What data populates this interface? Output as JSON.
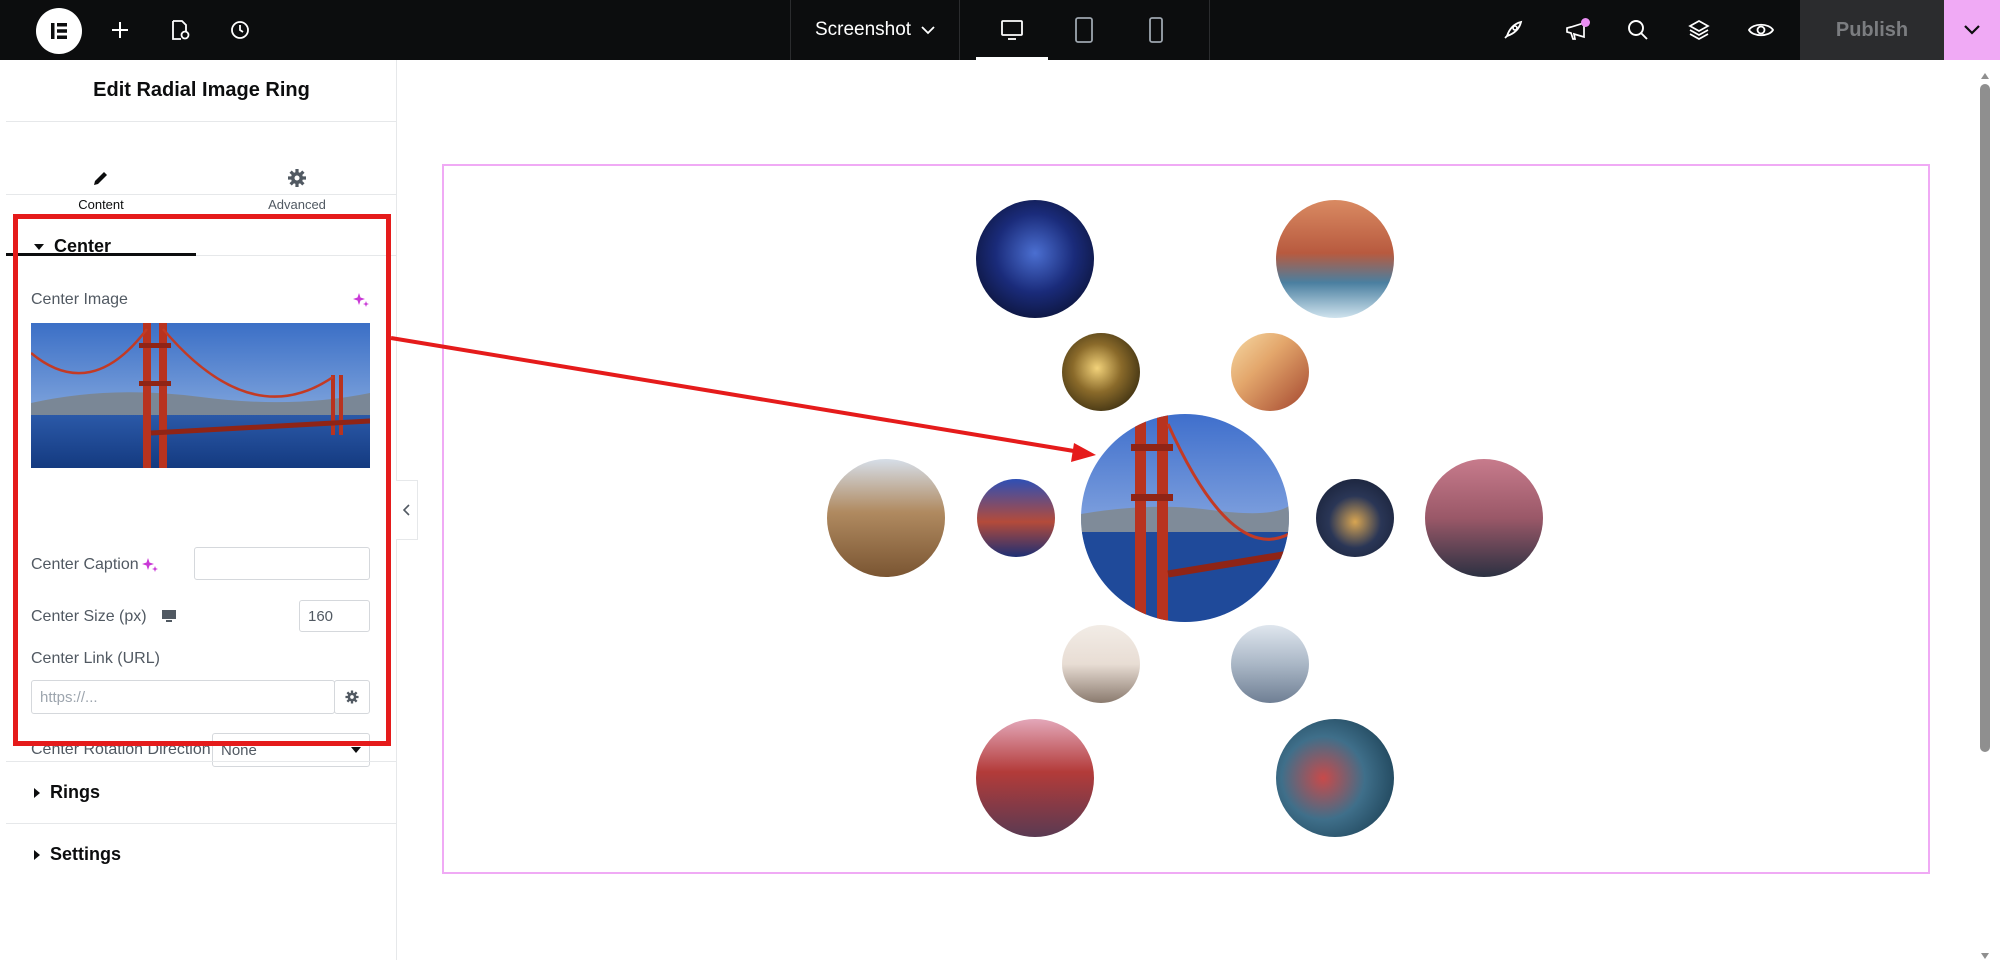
{
  "topbar": {
    "doc_title": "Screenshot",
    "publish_label": "Publish",
    "icons": [
      "elementor-logo-icon",
      "add-icon",
      "page-settings-icon",
      "history-icon",
      "desktop-icon",
      "tablet-icon",
      "mobile-icon",
      "rocket-icon",
      "announcement-icon",
      "search-icon",
      "layers-icon",
      "preview-eye-icon",
      "chevron-down-icon"
    ]
  },
  "panel": {
    "title": "Edit Radial Image Ring",
    "tabs": [
      {
        "label": "Content",
        "icon": "pencil-icon"
      },
      {
        "label": "Advanced",
        "icon": "gear-icon"
      }
    ]
  },
  "center_section": {
    "heading": "Center",
    "center_image_label": "Center Image",
    "center_caption_label": "Center Caption",
    "center_caption_value": "",
    "center_size_label": "Center Size (px)",
    "center_size_value": "160",
    "center_link_label": "Center Link (URL)",
    "center_link_placeholder": "https://...",
    "rotation_label": "Center Rotation Direction",
    "rotation_value": "None"
  },
  "sections": {
    "rings": "Rings",
    "settings": "Settings"
  },
  "colors": {
    "accent_pink": "#f0aaf5",
    "highlight_red": "#e51b1b",
    "topbar_bg": "#0c0d0e"
  }
}
